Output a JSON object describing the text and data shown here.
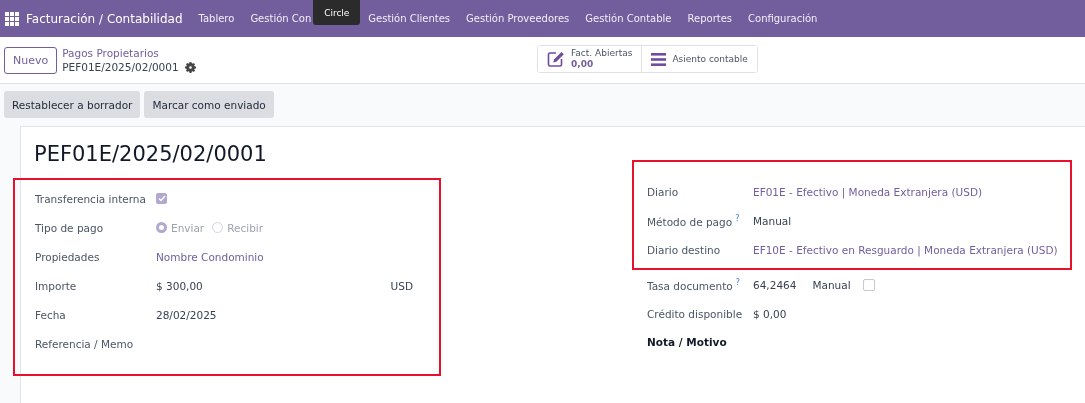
{
  "navbar": {
    "app_title": "Facturación / Contabilidad",
    "menu": [
      {
        "label": "Tablero"
      },
      {
        "label": "Gestión Con"
      },
      {
        "label": "Gestión Clientes"
      },
      {
        "label": "Gestión Proveedores"
      },
      {
        "label": "Gestión Contable"
      },
      {
        "label": "Reportes"
      },
      {
        "label": "Configuración"
      }
    ],
    "tooltip": "Circle"
  },
  "control_panel": {
    "new_button": "Nuevo",
    "breadcrumb": "Pagos Propietarios",
    "record": "PEF01E/2025/02/0001",
    "smart_buttons": [
      {
        "kind": "stat",
        "label": "Fact. Abiertas",
        "value": "0,00"
      },
      {
        "kind": "list",
        "label": "Asiento contable"
      }
    ]
  },
  "actions": [
    "Restablecer a borrador",
    "Marcar como enviado"
  ],
  "form": {
    "title": "PEF01E/2025/02/0001",
    "left": [
      {
        "highlighted": true,
        "fields": [
          {
            "kind": "checkbox",
            "label": "Transferencia interna",
            "checked": true
          },
          {
            "kind": "radio",
            "label": "Tipo de pago",
            "options": [
              {
                "label": "Enviar",
                "selected": true
              },
              {
                "label": "Recibir",
                "selected": false
              }
            ]
          },
          {
            "kind": "link",
            "label": "Propiedades",
            "value": "Nombre Condominio"
          },
          {
            "kind": "amount",
            "label": "Importe",
            "value": "$ 300,00",
            "currency": "USD"
          },
          {
            "kind": "text",
            "label": "Fecha",
            "value": "28/02/2025"
          },
          {
            "kind": "text",
            "label": "Referencia / Memo"
          }
        ]
      }
    ],
    "right": [
      {
        "highlighted": true,
        "fields": [
          {
            "kind": "link",
            "label": "Diario",
            "value": "EF01E - Efectivo | Moneda Extranjera (USD)"
          },
          {
            "kind": "text",
            "label": "Método de pago",
            "help": "?",
            "value": "Manual"
          },
          {
            "kind": "link",
            "label": "Diario destino",
            "value": "EF10E - Efectivo en Resguardo | Moneda Extranjera (USD)"
          }
        ]
      },
      {
        "highlighted": false,
        "fields": [
          {
            "kind": "rate",
            "label": "Tasa documento",
            "help": "?",
            "value": "64,2464",
            "option": "Manual",
            "checked": false
          },
          {
            "kind": "text",
            "label": "Crédito disponible",
            "value": "$ 0,00"
          },
          {
            "kind": "heading",
            "label": "Nota / Motivo"
          }
        ]
      }
    ]
  }
}
